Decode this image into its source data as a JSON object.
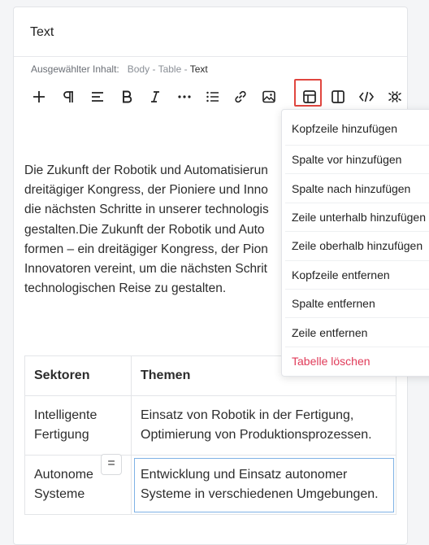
{
  "card": {
    "title": "Text"
  },
  "breadcrumb": {
    "label": "Ausgewählter Inhalt:",
    "items": [
      "Body",
      "Table",
      "Text"
    ],
    "separator": "-"
  },
  "toolbar": {
    "buttons": [
      {
        "icon": "plus-icon"
      },
      {
        "icon": "paragraph-icon"
      },
      {
        "icon": "align-icon"
      },
      {
        "icon": "bold-icon",
        "glyph": "B"
      },
      {
        "icon": "italic-icon",
        "glyph": "I"
      },
      {
        "icon": "more-icon"
      },
      {
        "icon": "list-icon"
      },
      {
        "icon": "link-icon"
      },
      {
        "icon": "image-icon"
      },
      {
        "icon": "table-icon",
        "active": true
      },
      {
        "icon": "columns-icon"
      },
      {
        "icon": "code-icon"
      },
      {
        "icon": "focus-icon"
      }
    ]
  },
  "body_text": {
    "lines": [
      "Die Zukunft der Robotik und Automatisierun",
      "dreitägiger Kongress, der Pioniere und Inno",
      "die nächsten Schritte in unserer technologis",
      "gestalten.Die Zukunft der Robotik und Auto",
      "formen – ein dreitägiger Kongress, der Pion",
      "Innovatoren vereint, um die nächsten Schrit",
      "technologischen Reise zu gestalten."
    ]
  },
  "table": {
    "headers": [
      "Sektoren",
      "Themen"
    ],
    "rows": [
      [
        "Intelligente Fertigung",
        "Einsatz von Robotik in der Fertigung, Optimierung von Produktionsprozessen."
      ],
      [
        "Autonome Systeme",
        "Entwicklung und Einsatz autonomer Systeme in verschiedenen Umgebungen."
      ]
    ]
  },
  "row_handle": "=",
  "table_menu": {
    "items": [
      "Kopfzeile hinzufügen",
      "Spalte vor hinzufügen",
      "Spalte nach hinzufügen",
      "Zeile unterhalb hinzufügen",
      "Zeile oberhalb hinzufügen",
      "Kopfzeile entfernen",
      "Spalte entfernen",
      "Zeile entfernen",
      "Tabelle löschen"
    ]
  },
  "colors": {
    "accent_highlight": "#e0463f",
    "danger": "#e03b59",
    "focus": "#7fb2e5"
  }
}
